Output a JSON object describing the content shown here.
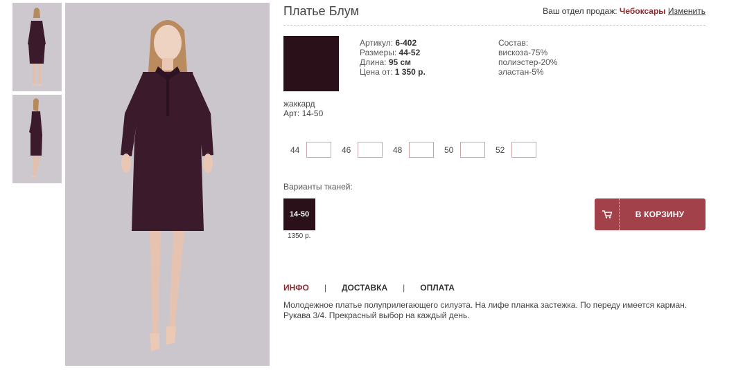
{
  "product": {
    "title": "Платье Блум"
  },
  "region": {
    "prefix": "Ваш отдел продаж:",
    "city": "Чебоксары",
    "change_label": "Изменить"
  },
  "fabric": {
    "name": "жаккард",
    "art": "Арт: 14-50",
    "color": "#2a1018"
  },
  "specs": {
    "article_label": "Артикул:",
    "article_value": "6-402",
    "sizes_label": "Размеры:",
    "sizes_value": "44-52",
    "length_label": "Длина:",
    "length_value": "95 см",
    "price_label": "Цена от:",
    "price_value": "1 350 р."
  },
  "composition": {
    "label": "Состав:",
    "items": [
      "вискоза-75%",
      "полиэстер-20%",
      "эластан-5%"
    ]
  },
  "sizes": [
    {
      "label": "44",
      "value": ""
    },
    {
      "label": "46",
      "value": ""
    },
    {
      "label": "48",
      "value": ""
    },
    {
      "label": "50",
      "value": ""
    },
    {
      "label": "52",
      "value": ""
    }
  ],
  "variants": {
    "label": "Варианты тканей:",
    "items": [
      {
        "label": "14-50",
        "price": "1350 р."
      }
    ]
  },
  "cart": {
    "label": "В КОРЗИНУ"
  },
  "tabs": [
    {
      "label": "ИНФО",
      "active": true
    },
    {
      "label": "ДОСТАВКА",
      "active": false
    },
    {
      "label": "ОПЛАТА",
      "active": false
    }
  ],
  "tab_separator": "|",
  "description": "Молодежное платье полуприлегающего силуэта. На лифе планка застежка. По переду имеется карман. Рукава 3/4. Прекрасный выбор на каждый день.",
  "colors": {
    "accent": "#a2414a",
    "brand_text": "#8b2a2f",
    "dress": "#3b1a2b"
  }
}
